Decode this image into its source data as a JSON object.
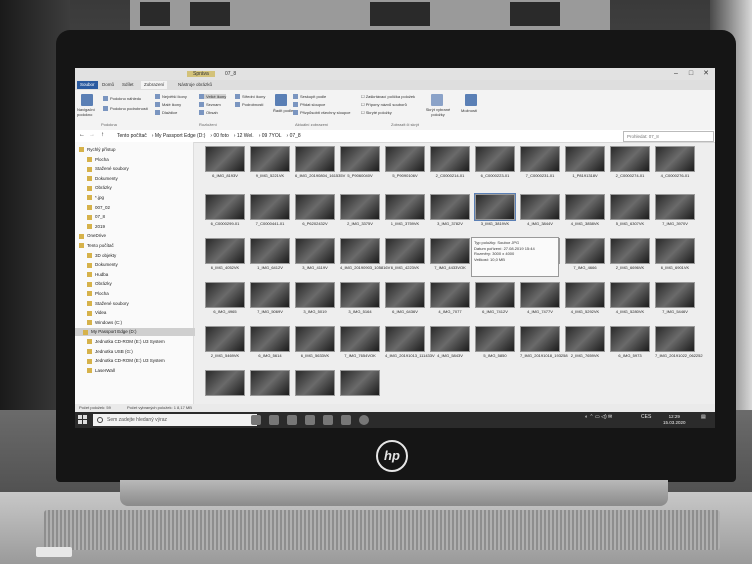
{
  "window": {
    "title_context": "Správa",
    "title_tab": "07_8",
    "ribbon_tabs": [
      "Soubor",
      "Domů",
      "Sdílet",
      "Zobrazení",
      "Nástroje obrázků"
    ]
  },
  "ribbon": {
    "panes": {
      "nav_pane": "Navigační podokno",
      "preview_pane": "Podokno náhledu",
      "details_pane": "Podokno podrobností",
      "label": "Podokna"
    },
    "layout": {
      "items": [
        "Největší ikony",
        "Velké ikony",
        "Střední ikony",
        "Malé ikony",
        "Seznam",
        "Podrobnosti",
        "Dlaždice",
        "Obsah"
      ],
      "label": "Rozložení"
    },
    "current_view": {
      "sort": "Řadit podle",
      "group": "Seskupit podle",
      "add_columns": "Přidat sloupce",
      "fit_columns": "Přizpůsobit všechny sloupce",
      "label": "Aktuální zobrazení"
    },
    "show_hide": {
      "checkbox_items": "Zaškrtávací políčka položek",
      "extensions": "Přípony názvů souborů",
      "hidden": "Skryté položky",
      "hide_selected": "Skrýt vybrané položky",
      "label": "Zobrazit či skrýt"
    },
    "options": "Možnosti"
  },
  "address": {
    "crumbs": [
      "Tento počítač",
      "My Passport Edge (D:)",
      "00 foto",
      "12 Wel.",
      "09 7YOL",
      "07_8"
    ],
    "search_placeholder": "Prohledat: 07_8"
  },
  "nav": {
    "items": [
      "Rychlý přístup",
      "Plocha",
      "Stažené soubory",
      "Dokumenty",
      "Obrázky",
      "*.jpg",
      "007_02",
      "07_8",
      "2019",
      "OneDrive",
      "Tento počítač",
      "3D objekty",
      "Dokumenty",
      "Hudba",
      "Obrázky",
      "Plocha",
      "Stažené soubory",
      "Videa",
      "Windows (C:)",
      "My Passport Edge (D:)",
      "Jednotka CD-ROM (E:) U3 System",
      "Jednotka USB (G:)",
      "Jednotka CD-ROM (E:) U3 System",
      "LaserWall"
    ],
    "selected_index": 19
  },
  "files": [
    "6_IMG_8193V",
    "9_IMG_5221VK",
    "6_IMG_20190804_161535V",
    "5_P9060040V",
    "5_P9090106V",
    "2_C0000214-01",
    "6_C0000223-01",
    "7_C0000231-01",
    "1_P8191318V",
    "2_C0000274-01",
    "4_C0000276-01",
    "6_C0000299-01",
    "7_C0000441-01",
    "6_P6202432V",
    "2_IMG_3375V",
    "1_IMG_3759VK",
    "3_IMG_3782V",
    "3_IMG_3819VK",
    "4_IMG_3844V",
    "4_IMG_3858VK",
    "5_IMG_6307VK",
    "7_IMG_3970V",
    "6_IMG_4052VK",
    "1_IMG_6412V",
    "3_IMG_4119V",
    "4_IMG_20190903_105816V",
    "6_IMG_4223VK",
    "7_IMG_4433VOK",
    "7_IMG_4467VK",
    "7_IMG_4589",
    "7_IMG_4666",
    "2_IMG_6696VK",
    "6_IMG_6901VK",
    "6_IMG_4965",
    "7_IMG_5069V",
    "3_IMG_5019",
    "3_IMG_5164",
    "6_IMG_6436V",
    "4_IMG_7077",
    "6_IMG_7412V",
    "4_IMG_7477V",
    "4_IMG_5292VK",
    "4_IMG_5280VK",
    "7_IMG_5446V",
    "2_IMG_5469VK",
    "6_IMG_5614",
    "6_IMG_5633VK",
    "7_IMG_7654VOK",
    "4_IMG_20191013_111433V",
    "4_IMG_5843V",
    "5_IMG_5850",
    "7_IMG_20191018_193258",
    "2_IMG_7659VK",
    "6_IMG_5973",
    "7_IMG_20191022_062252",
    "",
    "",
    "",
    ""
  ],
  "tooltip": {
    "line1": "Typ položky: Soubor JPG",
    "line2": "Datum pořízení: 27.08.2019 15:44",
    "line3": "Rozměry: 3000 x 4000",
    "line4": "Velikost: 10,0 MB"
  },
  "status": {
    "count": "Počet položek: 59",
    "selected": "Počet vybraných položek: 1  8,17 MB"
  },
  "taskbar": {
    "search_placeholder": "Sem zadejte hledaný výraz",
    "lang": "CES",
    "time": "12:29",
    "date": "15.03.2020"
  },
  "brand": {
    "logo_text": "hp"
  },
  "colors": {
    "file_tab": "#2a5aa0",
    "taskbar": "#2b2b2b"
  }
}
